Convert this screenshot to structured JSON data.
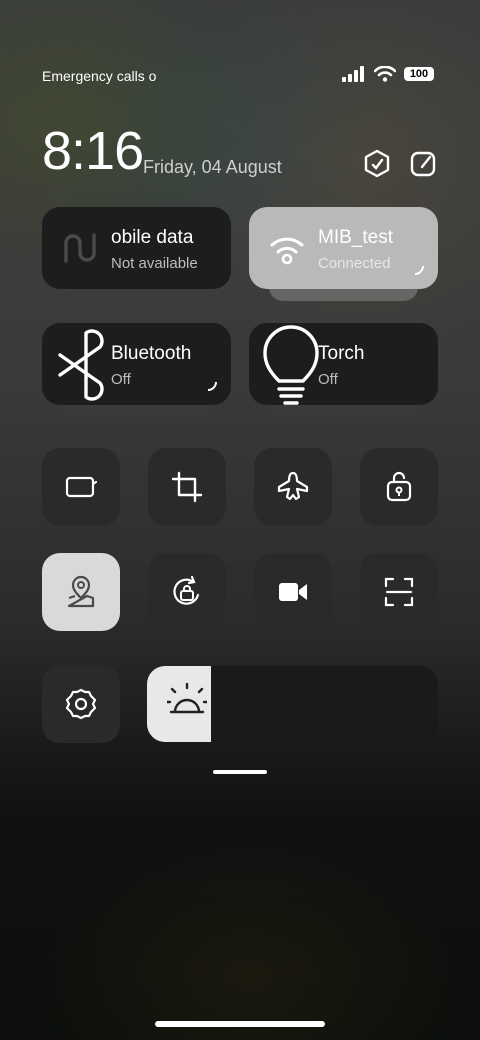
{
  "status_bar": {
    "carrier_text": "Emergency calls o",
    "battery": "100"
  },
  "header": {
    "time": "8:16",
    "date": "Friday, 04 August"
  },
  "tiles": {
    "mobile_data": {
      "title": "obile data",
      "subtitle": "Not available"
    },
    "wifi": {
      "title": "MIB_test",
      "subtitle": "Connected"
    },
    "bluetooth": {
      "title": "Bluetooth",
      "subtitle": "Off"
    },
    "torch": {
      "title": "Torch",
      "subtitle": "Off"
    }
  },
  "toggles": [
    {
      "icon": "auto-rotate-icon",
      "active": false
    },
    {
      "icon": "crop-screenshot-icon",
      "active": false
    },
    {
      "icon": "airplane-mode-icon",
      "active": false
    },
    {
      "icon": "lock-rotation-icon",
      "active": false
    },
    {
      "icon": "location-icon",
      "active": true
    },
    {
      "icon": "rotation-lock-icon",
      "active": false
    },
    {
      "icon": "screen-record-icon",
      "active": false
    },
    {
      "icon": "scanner-icon",
      "active": false
    },
    {
      "icon": "settings-gear-icon",
      "active": false
    }
  ],
  "brightness": {
    "level_fraction": 0.22
  },
  "colors": {
    "tile_dark": "#1d1d1d",
    "tile_light": "#b9b9b9",
    "toggle_bg": "#2a2a2a",
    "toggle_active": "#d9d9d9"
  }
}
